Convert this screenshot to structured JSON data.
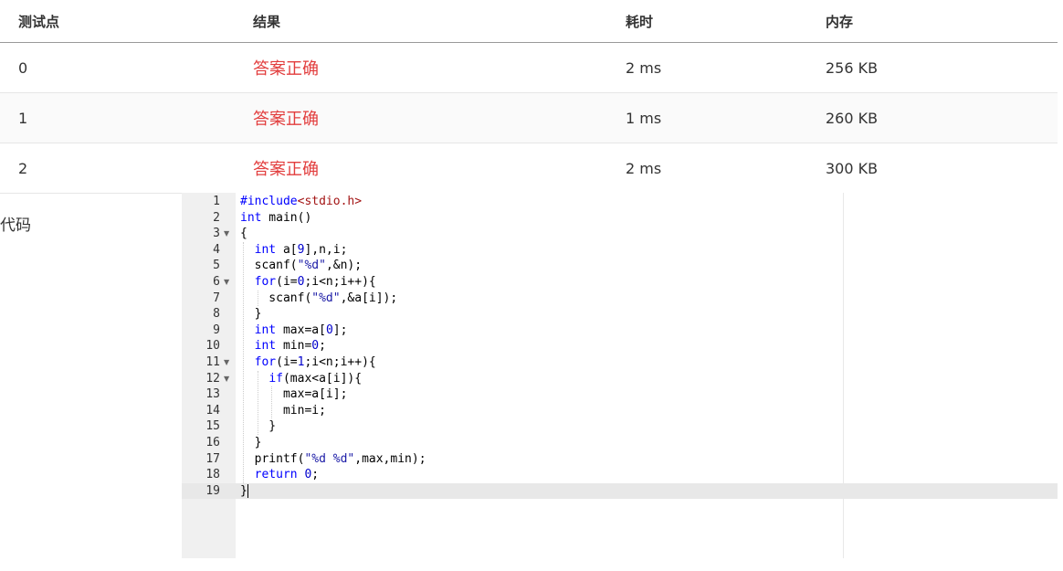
{
  "table": {
    "headers": [
      "测试点",
      "结果",
      "耗时",
      "内存"
    ],
    "rows": [
      {
        "case": "0",
        "result": "答案正确",
        "time": "2 ms",
        "memory": "256 KB"
      },
      {
        "case": "1",
        "result": "答案正确",
        "time": "1 ms",
        "memory": "260 KB"
      },
      {
        "case": "2",
        "result": "答案正确",
        "time": "2 ms",
        "memory": "300 KB"
      }
    ]
  },
  "code_section": {
    "label": "代码",
    "lines": [
      "#include<stdio.h>",
      "int main()",
      "{",
      "  int a[9],n,i;",
      "  scanf(\"%d\",&n);",
      "  for(i=0;i<n;i++){",
      "    scanf(\"%d\",&a[i]);",
      "  }",
      "  int max=a[0];",
      "  int min=0;",
      "  for(i=1;i<n;i++){",
      "    if(max<a[i]){",
      "      max=a[i];",
      "      min=i;",
      "    }",
      "  }",
      "  printf(\"%d %d\",max,min);",
      "  return 0;",
      "}"
    ],
    "line_numbers": [
      "1",
      "2",
      "3",
      "4",
      "5",
      "6",
      "7",
      "8",
      "9",
      "10",
      "11",
      "12",
      "13",
      "14",
      "15",
      "16",
      "17",
      "18",
      "19"
    ],
    "fold_lines": [
      3,
      6,
      11,
      12
    ],
    "active_line": 19
  },
  "colors": {
    "keyword": "#0000ff",
    "string": "#1a1aa6",
    "number": "#0000cd",
    "include_target": "#a31515",
    "result_ok": "#e23d3d"
  }
}
